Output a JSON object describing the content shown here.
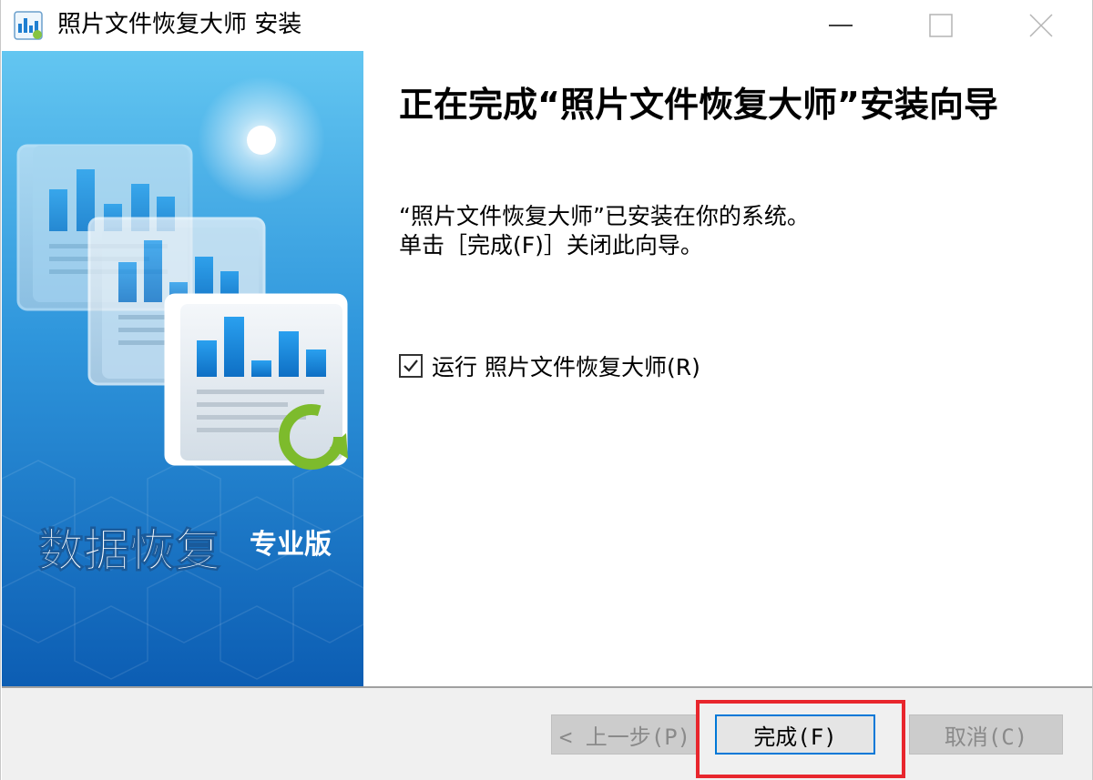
{
  "window": {
    "title": "照片文件恢复大师 安装"
  },
  "banner": {
    "brand_main": "数据恢复",
    "brand_sub": "专业版"
  },
  "content": {
    "heading": "正在完成“照片文件恢复大师”安装向导",
    "line1": "“照片文件恢复大师”已安装在你的系统。",
    "line2": "单击［完成(F)］关闭此向导。",
    "run_checkbox": {
      "label": "运行 照片文件恢复大师(R)",
      "checked": true
    }
  },
  "buttons": {
    "back": "< 上一步(P)",
    "finish": "完成(F)",
    "cancel": "取消(C)"
  },
  "colors": {
    "accent": "#0078d7",
    "highlight": "#e8262d",
    "banner_top": "#5ec3f0",
    "banner_bottom": "#0d63b8"
  },
  "icons": {
    "app": "bar-chart-icon",
    "minimize": "minimize-icon",
    "maximize": "maximize-icon",
    "close": "close-icon",
    "check": "check-icon",
    "refresh": "refresh-icon"
  }
}
